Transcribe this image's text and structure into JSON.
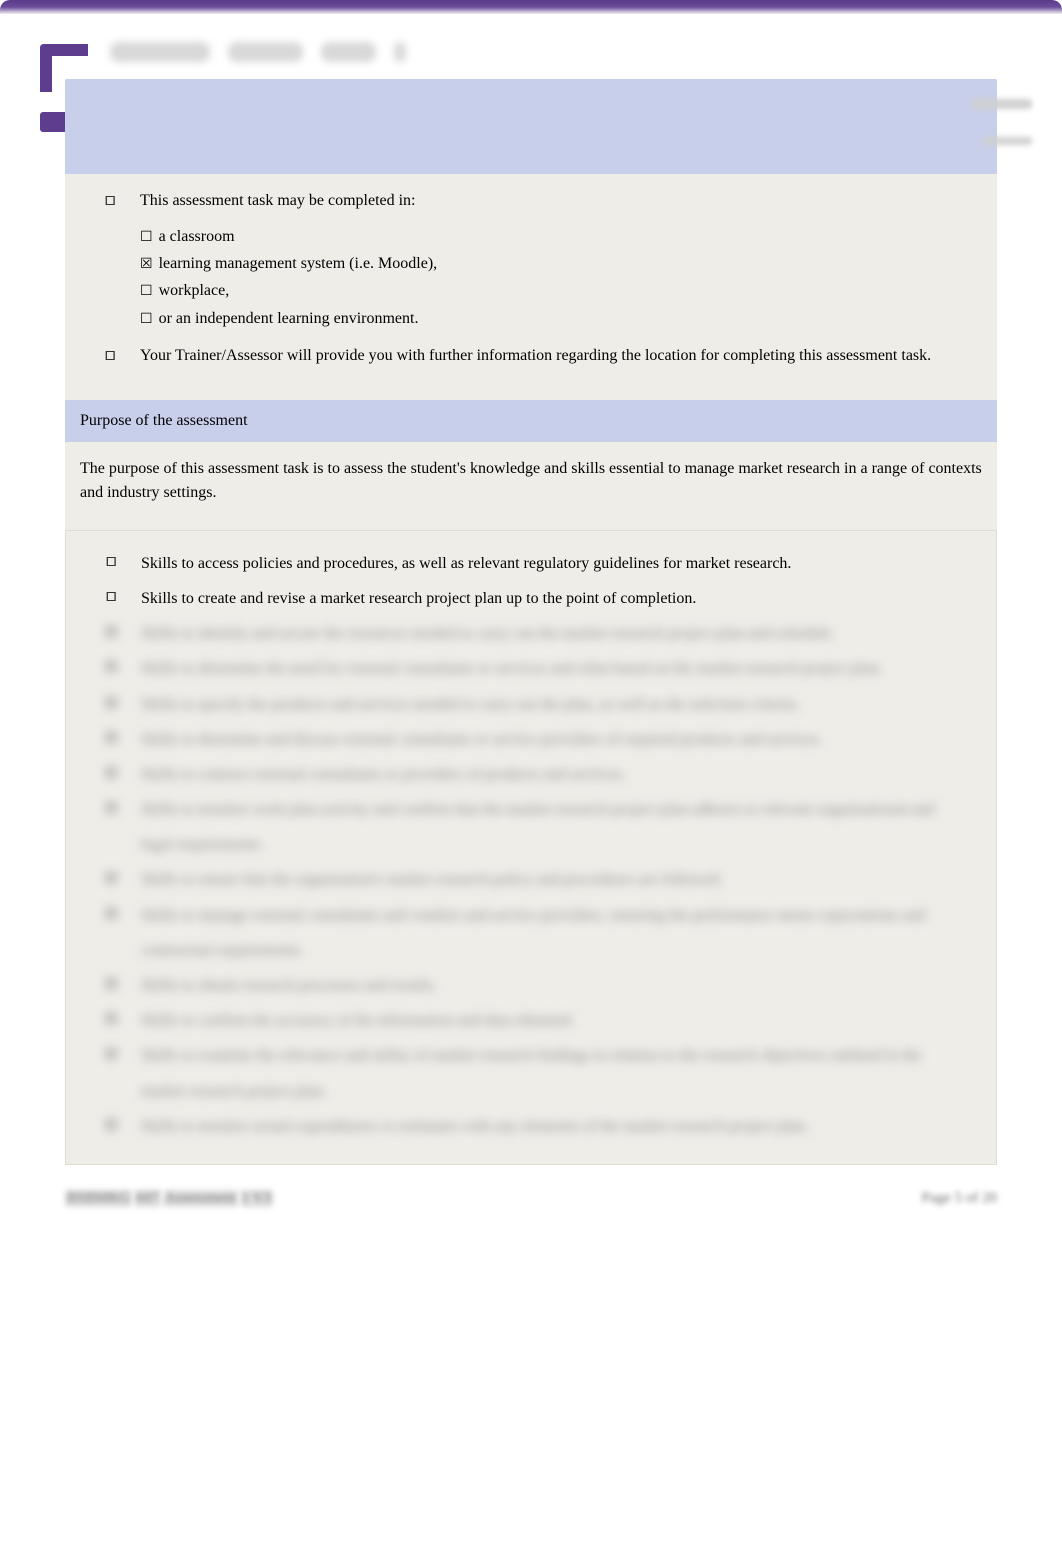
{
  "assessment": {
    "intro": "This assessment task may be completed in:",
    "options": [
      {
        "checked": false,
        "label": "a classroom"
      },
      {
        "checked": true,
        "label": "learning management system (i.e. Moodle),"
      },
      {
        "checked": false,
        "label": "workplace,"
      },
      {
        "checked": false,
        "label": "or an independent learning environment."
      }
    ],
    "trainer_note": "Your Trainer/Assessor will provide you with further information regarding the location for completing this assessment task."
  },
  "purpose": {
    "header": "Purpose of the assessment",
    "text": "The purpose of this assessment task is to assess the student's knowledge and skills essential to manage market research in a range of contexts and industry settings."
  },
  "skills": {
    "visible": [
      "Skills to access policies and procedures, as well as relevant regulatory guidelines for market research.",
      "Skills to create and revise a market research project plan up to the point of completion."
    ],
    "blurred": [
      "Skills to identify and secure the resources needed to carry out the market research project plan and schedule.",
      "Skills to determine the need for external consultants or services and what based on the market research project plan.",
      "Skills to specify the products and services needed to carry out the plan, as well as the selection criteria.",
      "Skills to determine and discuss external consultants or service providers of required products and services.",
      "Skills to contract external consultants or providers of products and services.",
      "Skills to monitor work plan activity and confirm that the market research project plan adheres to relevant organisational and legal requirements.",
      "Skills to ensure that the organisation's market research policy and procedures are followed.",
      "Skills to manage external consultants and vendors and service providers, ensuring the performance meets expectations and contractual requirements.",
      "Skills to obtain research processes and results.",
      "Skills to confirm the accuracy of the information and data obtained.",
      "Skills to examine the relevance and utility of market research findings in relation to the research objectives outlined in the market research project plan.",
      "Skills to monitor actual expenditures vs estimates with any elements of the market research project plan."
    ]
  },
  "footer": {
    "code_prefix": "BSBMKG",
    "code_suffix": "607",
    "assessment_label": " Assessment ",
    "version": "1 V3",
    "page_label": "Page 5 of 20"
  }
}
